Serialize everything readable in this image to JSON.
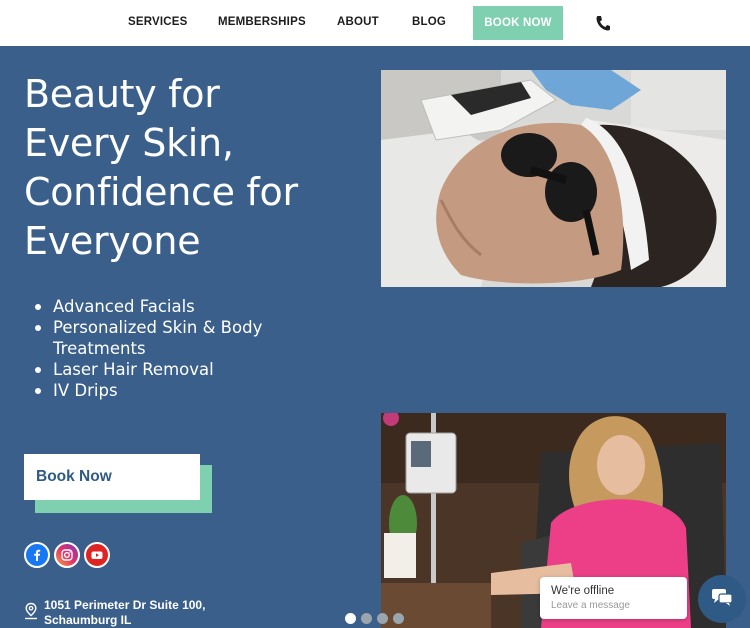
{
  "nav": {
    "services": "SERVICES",
    "memberships": "MEMBERSHIPS",
    "about": "ABOUT",
    "blog": "BLOG",
    "book_now": "BOOK NOW",
    "phone_icon": "phone-icon"
  },
  "hero": {
    "title_lines": [
      "Beauty for",
      "Every Skin,",
      "Confidence for",
      "Everyone"
    ],
    "features": [
      "Advanced Facials",
      "Personalized Skin & Body Treatments",
      "Laser Hair Removal",
      "IV Drips"
    ],
    "cta_label": "Book Now"
  },
  "social": [
    {
      "name": "facebook-icon",
      "color": "#1877f2"
    },
    {
      "name": "instagram-icon",
      "color": "#e1306c"
    },
    {
      "name": "youtube-icon",
      "color": "#e02424"
    }
  ],
  "address": {
    "line1": "1051 Perimeter Dr Suite 100,",
    "line2": "Schaumburg IL"
  },
  "carousel": {
    "count": 4,
    "active": 0
  },
  "chat": {
    "title": "We're offline",
    "subtitle": "Leave a message"
  },
  "colors": {
    "background": "#3a5f8a",
    "accent": "#7fcfb1",
    "nav_bg": "#ffffff"
  }
}
